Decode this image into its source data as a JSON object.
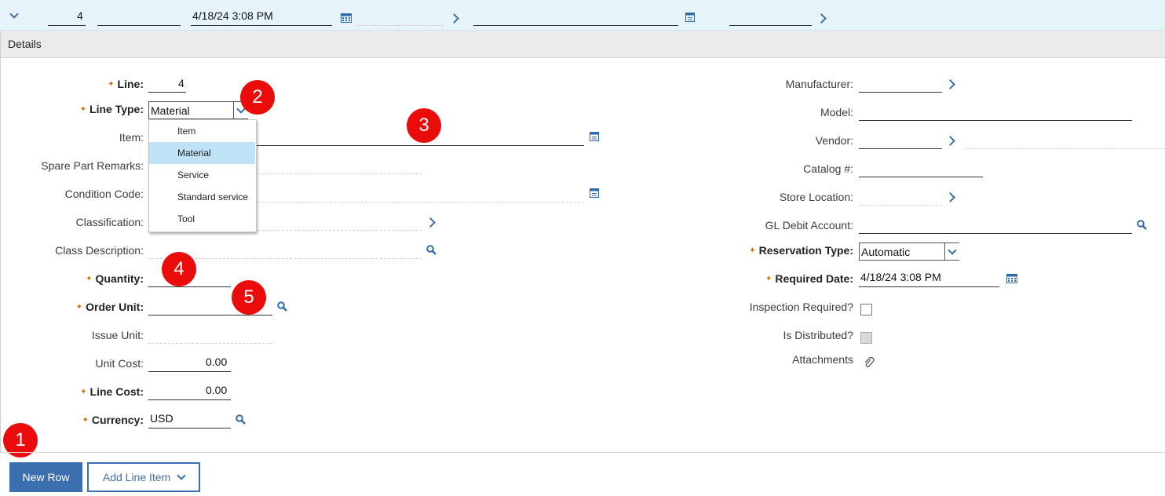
{
  "top_row": {
    "line_number": "4",
    "date": "4/18/24 3:08 PM"
  },
  "details_title": "Details",
  "left_fields": {
    "line": {
      "label": "Line:",
      "value": "4"
    },
    "line_type": {
      "label": "Line Type:",
      "value": "Material"
    },
    "item": {
      "label": "Item:"
    },
    "spare_part_remarks": {
      "label": "Spare Part Remarks:"
    },
    "condition_code": {
      "label": "Condition Code:"
    },
    "classification": {
      "label": "Classification:"
    },
    "class_description": {
      "label": "Class Description:"
    },
    "quantity": {
      "label": "Quantity:"
    },
    "order_unit": {
      "label": "Order Unit:"
    },
    "issue_unit": {
      "label": "Issue Unit:"
    },
    "unit_cost": {
      "label": "Unit Cost:",
      "value": "0.00"
    },
    "line_cost": {
      "label": "Line Cost:",
      "value": "0.00"
    },
    "currency": {
      "label": "Currency:",
      "value": "USD"
    }
  },
  "line_type_options": [
    "Item",
    "Material",
    "Service",
    "Standard service",
    "Tool"
  ],
  "line_type_selected": "Material",
  "right_fields": {
    "manufacturer": {
      "label": "Manufacturer:"
    },
    "model": {
      "label": "Model:"
    },
    "vendor": {
      "label": "Vendor:"
    },
    "catalog": {
      "label": "Catalog #:"
    },
    "store_location": {
      "label": "Store Location:"
    },
    "gl_debit_account": {
      "label": "GL Debit Account:"
    },
    "reservation_type": {
      "label": "Reservation Type:",
      "value": "Automatic"
    },
    "required_date": {
      "label": "Required Date:",
      "value": "4/18/24 3:08 PM"
    },
    "inspection_required": {
      "label": "Inspection Required?",
      "checked": false
    },
    "is_distributed": {
      "label": "Is Distributed?",
      "checked": false,
      "disabled": true
    },
    "attachments": {
      "label": "Attachments"
    }
  },
  "callouts": [
    "1",
    "2",
    "3",
    "4",
    "5"
  ],
  "buttons": {
    "new_row": "New Row",
    "add_line_item": "Add Line Item"
  },
  "colors": {
    "accent": "#3c6fae",
    "callout": "#ea0b0b",
    "required": "#d86a00",
    "highlight": "#bfe2f6"
  }
}
